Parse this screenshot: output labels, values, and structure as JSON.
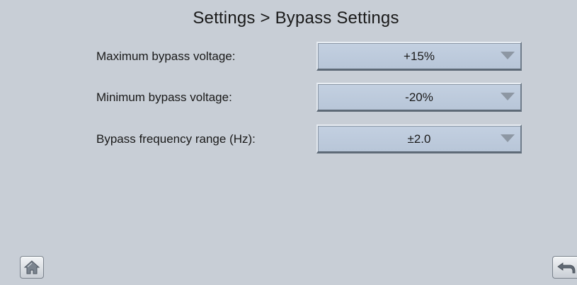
{
  "header": {
    "title": "Settings > Bypass Settings"
  },
  "settings": [
    {
      "label": "Maximum bypass voltage:",
      "value": "+15%"
    },
    {
      "label": "Minimum bypass voltage:",
      "value": "-20%"
    },
    {
      "label": "Bypass frequency range (Hz):",
      "value": "±2.0"
    }
  ],
  "footer": {
    "home_icon": "home-icon",
    "back_icon": "back-arrow-icon"
  },
  "colors": {
    "background": "#c8ced6",
    "dropdown": "#bccadb",
    "text": "#1a1a1a"
  }
}
